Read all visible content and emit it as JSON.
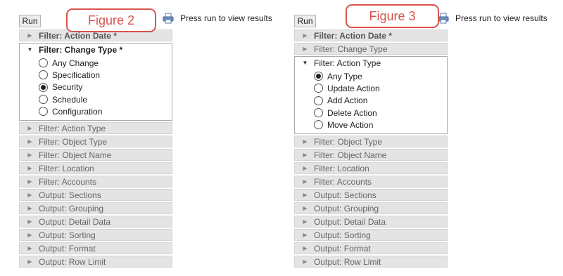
{
  "panels": [
    {
      "figure_label": "Figure 2",
      "run_label": "Run",
      "status_text": "Press run to view results",
      "rows_before": [
        {
          "label": "Filter: Action Date *",
          "required": true
        }
      ],
      "open_section": {
        "label": "Filter: Change Type *",
        "required": true,
        "options": [
          "Any Change",
          "Specification",
          "Security",
          "Schedule",
          "Configuration"
        ],
        "selected_index": 2
      },
      "rows_after": [
        {
          "label": "Filter: Action Type"
        },
        {
          "label": "Filter: Object Type"
        },
        {
          "label": "Filter: Object Name"
        },
        {
          "label": "Filter: Location"
        },
        {
          "label": "Filter: Accounts"
        },
        {
          "label": "Output: Sections"
        },
        {
          "label": "Output: Grouping"
        },
        {
          "label": "Output: Detail Data"
        },
        {
          "label": "Output: Sorting"
        },
        {
          "label": "Output: Format"
        },
        {
          "label": "Output: Row Limit"
        }
      ]
    },
    {
      "figure_label": "Figure 3",
      "run_label": "Run",
      "status_text": "Press run to view results",
      "rows_before": [
        {
          "label": "Filter: Action Date *",
          "required": true
        },
        {
          "label": "Filter: Change Type"
        }
      ],
      "open_section": {
        "label": "Filter: Action Type",
        "required": false,
        "options": [
          "Any Type",
          "Update Action",
          "Add Action",
          "Delete Action",
          "Move Action"
        ],
        "selected_index": 0
      },
      "rows_after": [
        {
          "label": "Filter: Object Type"
        },
        {
          "label": "Filter: Object Name"
        },
        {
          "label": "Filter: Location"
        },
        {
          "label": "Filter: Accounts"
        },
        {
          "label": "Output: Sections"
        },
        {
          "label": "Output: Grouping"
        },
        {
          "label": "Output: Detail Data"
        },
        {
          "label": "Output: Sorting"
        },
        {
          "label": "Output: Format"
        },
        {
          "label": "Output: Row Limit"
        }
      ]
    }
  ],
  "icons": {
    "collapsed_arrow": "triangle-right",
    "expanded_arrow": "triangle-down",
    "print_icon": "printer-icon"
  },
  "colors": {
    "annotation_red": "#d9534f",
    "row_background": "#e4e4e4"
  }
}
